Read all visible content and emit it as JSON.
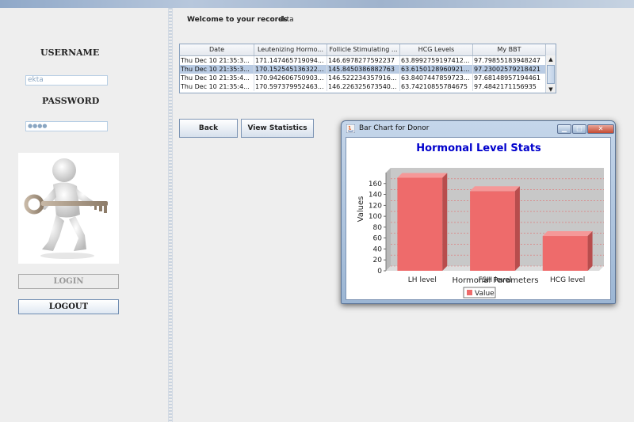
{
  "login_panel": {
    "username_label": "USERNAME",
    "username_value": "ekta",
    "password_label": "PASSWORD",
    "password_value": "●●●●",
    "login_button": "LOGIN",
    "logout_button": "LOGOUT"
  },
  "main": {
    "welcome_text": "Welcome to your records",
    "welcome_user": "ekta",
    "table": {
      "columns": [
        "Date",
        "Leutenizing Hormo...",
        "Follicle Stimulating ...",
        "HCG Levels",
        "My BBT"
      ],
      "rows": [
        [
          "Thu Dec 10 21:35:3...",
          "171.147465719094...",
          "146.6978277592237",
          "63.8992759197412...",
          "97.79855183948247"
        ],
        [
          "Thu Dec 10 21:35:3...",
          "170.152545136322...",
          "145.8450386882763",
          "63.6150128960921...",
          "97.23002579218421"
        ],
        [
          "Thu Dec 10 21:35:4...",
          "170.942606750903...",
          "146.522234357916...",
          "63.8407447859723...",
          "97.68148957194461"
        ],
        [
          "Thu Dec 10 21:35:4...",
          "170.597379952463...",
          "146.226325673540...",
          "63.7421085578467​5",
          "97.4842171156935"
        ]
      ],
      "selected_row": 1
    },
    "back_button": "Back",
    "view_stats_button": "View Statistics"
  },
  "chart_window": {
    "title": "Bar Chart for Donor",
    "controls": {
      "minimize": "minimize-icon",
      "maximize": "maximize-icon",
      "close": "close-icon"
    }
  },
  "chart_data": {
    "type": "bar",
    "title": "Hormonal Level Stats",
    "xlabel": "Hormonal Parameters",
    "ylabel": "Values",
    "categories": [
      "LH level",
      "FSH level",
      "HCG level"
    ],
    "series": [
      {
        "name": "Value",
        "values": [
          170.6,
          146.2,
          63.8
        ]
      }
    ],
    "ylim": [
      0,
      180
    ],
    "yticks": [
      0,
      20,
      40,
      60,
      80,
      100,
      120,
      140,
      160
    ],
    "grid": true,
    "legend_position": "bottom",
    "colors": {
      "bar": "#ee6b6b",
      "bar_side": "#b84d4d",
      "bar_top": "#f59898",
      "title": "#0000cc",
      "grid": "#e07070"
    }
  }
}
